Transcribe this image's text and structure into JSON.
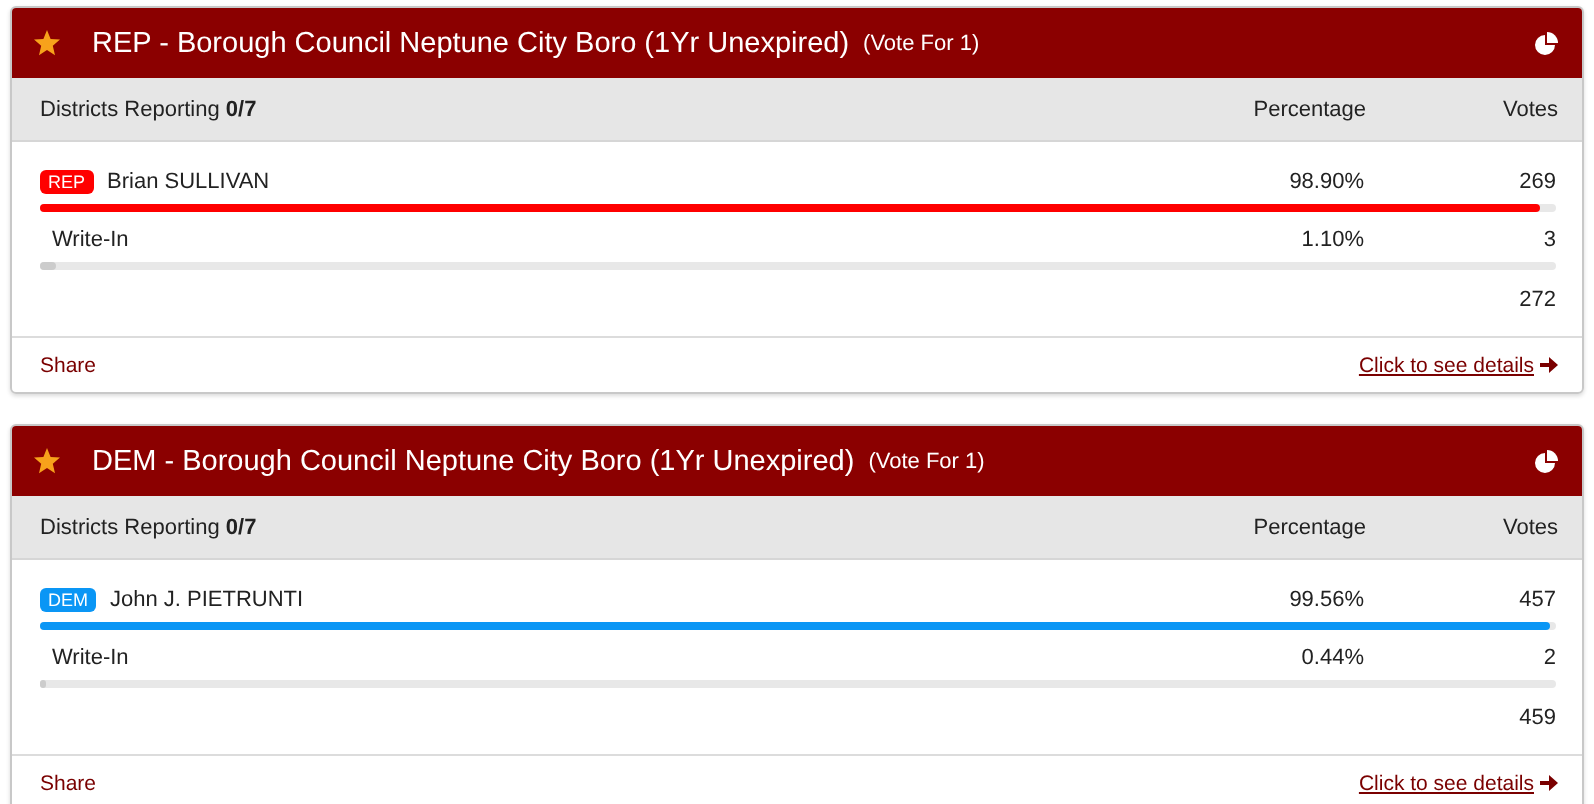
{
  "races": [
    {
      "title": "REP - Borough Council Neptune City Boro (1Yr Unexpired)",
      "vote_for": "(Vote For 1)",
      "districts": "Districts Reporting **0/7**",
      "columns": [
        "Percentage",
        "Votes"
      ],
      "candidates": [
        {
          "party": "REP",
          "name": "Brian SULLIVAN",
          "percentage": "98.90%",
          "votes": "269",
          "level": 0.989,
          "color": "#ff0000"
        },
        {
          "name": "Write-In",
          "percentage": "1.10%",
          "votes": "3",
          "level": 0.011,
          "color": "#cccccc"
        }
      ],
      "total": "272",
      "share": "Share",
      "details": "Click to see details"
    },
    {
      "title": "DEM - Borough Council Neptune City Boro (1Yr Unexpired)",
      "vote_for": "(Vote For 1)",
      "districts": "Districts Reporting **0/7**",
      "columns": [
        "Percentage",
        "Votes"
      ],
      "candidates": [
        {
          "party": "DEM",
          "name": "John J. PIETRUNTI",
          "percentage": "99.56%",
          "votes": "457",
          "level": 0.9956,
          "color": "#0a96f5"
        },
        {
          "name": "Write-In",
          "percentage": "0.44%",
          "votes": "2",
          "level": 0.0044,
          "color": "#cccccc"
        }
      ],
      "total": "459",
      "share": "Share",
      "details": "Click to see details"
    }
  ]
}
